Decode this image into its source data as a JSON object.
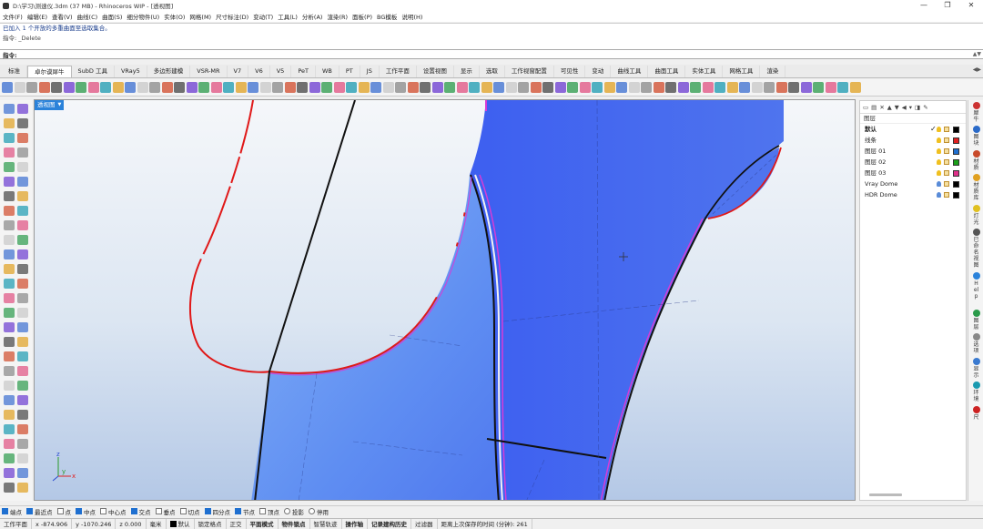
{
  "window": {
    "title": "D:\\学习\\测速仪.3dm (37 MB) - Rhinoceros WIP - [透视图]",
    "controls": [
      "—",
      "❐",
      "✕"
    ]
  },
  "menu": [
    "文件(F)",
    "编辑(E)",
    "查看(V)",
    "曲线(C)",
    "曲面(S)",
    "细分物件(U)",
    "实体(O)",
    "网格(M)",
    "尺寸标注(D)",
    "变动(T)",
    "工具(L)",
    "分析(A)",
    "渲染(R)",
    "面板(P)",
    "BG模板",
    "说明(H)"
  ],
  "command_history": {
    "line1": "已加入 1 个开放的多重曲面至选取集合。",
    "line2": "指令: _Delete"
  },
  "command_prompt": "指令:",
  "tabs": [
    "标准",
    "卓尔谟犀牛",
    "SubD 工具",
    "VRay5",
    "多边形建模",
    "VSR-MR",
    "V7",
    "V6",
    "V5",
    "PeT",
    "WB",
    "PT",
    "JS",
    "工作平面",
    "设置视图",
    "显示",
    "选取",
    "工作视窗配置",
    "可见性",
    "变动",
    "曲线工具",
    "曲面工具",
    "实体工具",
    "网格工具",
    "渲染"
  ],
  "active_tab_index": 1,
  "viewport": {
    "label": "透视图",
    "axis": {
      "x": "x",
      "y": "y",
      "z": "z"
    }
  },
  "layers_panel": {
    "header": "图层",
    "layers": [
      {
        "name": "默认",
        "current": true,
        "color": "#000000",
        "bulb": "yellow"
      },
      {
        "name": "线条",
        "current": false,
        "color": "#e02020",
        "bulb": "yellow"
      },
      {
        "name": "图层 01",
        "current": false,
        "color": "#1e6fd0",
        "bulb": "yellow"
      },
      {
        "name": "图层 02",
        "current": false,
        "color": "#1aa01a",
        "bulb": "yellow"
      },
      {
        "name": "图层 03",
        "current": false,
        "color": "#e0308a",
        "bulb": "yellow"
      },
      {
        "name": "Vray Dome",
        "current": false,
        "color": "#000000",
        "bulb": "blue"
      },
      {
        "name": "HDR Dome",
        "current": false,
        "color": "#000000",
        "bulb": "blue"
      }
    ],
    "current_mark": "✓"
  },
  "side_tabs": [
    {
      "label": "犀牛",
      "color": "#cc3333"
    },
    {
      "label": "图块",
      "color": "#2a6ac8"
    },
    {
      "label": "材质",
      "color": "#c84a2a"
    },
    {
      "label": "材质库",
      "color": "#e0a020"
    },
    {
      "label": "灯光",
      "color": "#e0c020"
    },
    {
      "label": "已命名视图",
      "color": "#555555"
    },
    {
      "label": "Help",
      "color": "#2a82da"
    },
    {
      "label": "图层",
      "color": "#2a9a4a"
    },
    {
      "label": "选项",
      "color": "#888888"
    },
    {
      "label": "显示",
      "color": "#3a7ad0"
    },
    {
      "label": "环境",
      "color": "#1a9ab0"
    },
    {
      "label": "尺",
      "color": "#cc2222"
    }
  ],
  "osnaps": [
    {
      "label": "端点",
      "on": true
    },
    {
      "label": "最近点",
      "on": true
    },
    {
      "label": "点",
      "on": false
    },
    {
      "label": "中点",
      "on": true
    },
    {
      "label": "中心点",
      "on": false
    },
    {
      "label": "交点",
      "on": true
    },
    {
      "label": "垂点",
      "on": false
    },
    {
      "label": "切点",
      "on": false
    },
    {
      "label": "四分点",
      "on": true
    },
    {
      "label": "节点",
      "on": true
    },
    {
      "label": "顶点",
      "on": false
    },
    {
      "label": "投影",
      "on": false,
      "round": true
    },
    {
      "label": "停用",
      "on": false,
      "round": true
    }
  ],
  "status": {
    "cplane": "工作平面",
    "x": "x -874.906",
    "y": "y -1070.246",
    "z": "z 0.000",
    "units": "毫米",
    "layer": "默认",
    "toggles": [
      "锁定格点",
      "正交",
      "平面模式",
      "物件锁点",
      "智慧轨迹",
      "操作轴",
      "记录建构历史",
      "过滤器"
    ],
    "toggles_bold": [
      false,
      false,
      true,
      true,
      false,
      true,
      true,
      false
    ],
    "autosave": "距离上次保存的时间 (分钟): 261"
  }
}
